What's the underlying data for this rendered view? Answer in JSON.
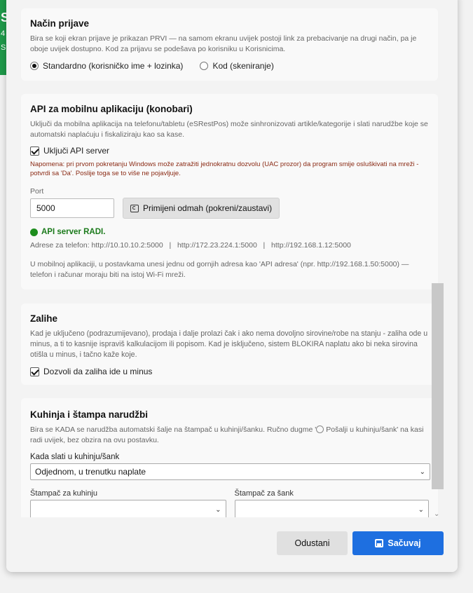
{
  "background": {
    "letters": [
      "S",
      "4",
      "Slo"
    ]
  },
  "login_mode": {
    "title": "Način prijave",
    "description": "Bira se koji ekran prijave je prikazan PRVI — na samom ekranu uvijek postoji link za prebacivanje na drugi način, pa je oboje uvijek dostupno. Kod za prijavu se podešava po korisniku u Korisnicima.",
    "option_standard": "Standardno (korisničko ime + lozinka)",
    "option_code": "Kod (skeniranje)",
    "selected": "Standardno (korisničko ime + lozinka)"
  },
  "api": {
    "title": "API za mobilnu aplikaciju (konobari)",
    "description": "Uključi da mobilna aplikacija na telefonu/tabletu (eSRestPos) može sinhronizovati artikle/kategorije i slati narudžbe koje se automatski naplaćuju i fiskaliziraju kao sa kase.",
    "enable_label": "Uključi API server",
    "enabled": true,
    "note": "Napomena: pri prvom pokretanju Windows može zatražiti jednokratnu dozvolu (UAC prozor) da program smije osluškivati na mreži - potvrdi sa 'Da'. Poslije toga se to više ne pojavljuje.",
    "port_label": "Port",
    "port_value": "5000",
    "apply_button": "Primijeni odmah (pokreni/zaustavi)",
    "status": "API server RADI.",
    "addresses": "Adrese za telefon: http://10.10.10.2:5000   |   http://172.23.224.1:5000   |   http://192.168.1.12:5000",
    "hint": "U mobilnoj aplikaciji, u postavkama unesi jednu od gornjih adresa kao 'API adresa' (npr. http://192.168.1.50:5000) — telefon i računar moraju biti na istoj Wi-Fi mreži."
  },
  "stock": {
    "title": "Zalihe",
    "description": "Kad je uključeno (podrazumijevano), prodaja i dalje prolazi čak i ako nema dovoljno sirovine/robe na stanju - zaliha ode u minus, a ti to kasnije ispraviš kalkulacijom ili popisom. Kad je isključeno, sistem BLOKIRA naplatu ako bi neka sirovina otišla u minus, i tačno kaže koje.",
    "allow_minus_label": "Dozvoli da zaliha ide u minus",
    "allow_minus": true
  },
  "kitchen": {
    "title": "Kuhinja i štampa narudžbi",
    "description_prefix": "Bira se KADA se narudžba automatski šalje na štampač u kuhinji/šanku. Ručno dugme '",
    "description_button": "Pošalji u kuhinju/šank",
    "description_suffix": "' na kasi radi uvijek, bez obzira na ovu postavku.",
    "when_label": "Kada slati u kuhinju/šank",
    "when_value": "Odjednom, u trenutku naplate",
    "kitchen_printer_label": "Štampač za kuhinju",
    "kitchen_printer_value": "",
    "bar_printer_label": "Štampač za šank",
    "bar_printer_value": ""
  },
  "footer": {
    "cancel": "Odustani",
    "save": "Sačuvaj"
  },
  "colors": {
    "primary": "#1e6fe0",
    "status_green": "#1e8e1e",
    "warning_text": "#8a2a14"
  }
}
